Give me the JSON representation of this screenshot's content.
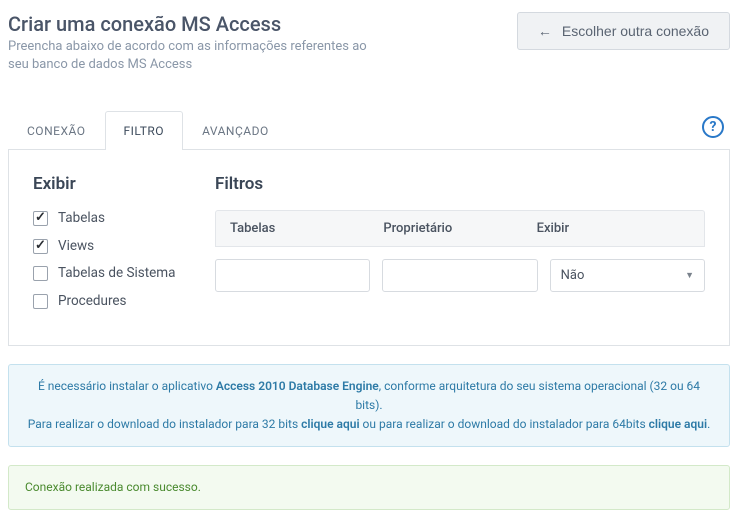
{
  "header": {
    "title": "Criar uma conexão MS Access",
    "subtitle": "Preencha abaixo de acordo com as informações referentes ao seu banco de dados MS Access",
    "choose_other": "Escolher outra conexão"
  },
  "tabs": {
    "items": [
      {
        "label": "CONEXÃO"
      },
      {
        "label": "FILTRO"
      },
      {
        "label": "AVANÇADO"
      }
    ]
  },
  "exibir_section": {
    "title": "Exibir",
    "options": [
      {
        "label": "Tabelas",
        "checked": true
      },
      {
        "label": "Views",
        "checked": true
      },
      {
        "label": "Tabelas de Sistema",
        "checked": false
      },
      {
        "label": "Procedures",
        "checked": false
      }
    ]
  },
  "filtros_section": {
    "title": "Filtros",
    "columns": {
      "tabelas": "Tabelas",
      "proprietario": "Proprietário",
      "exibir": "Exibir"
    },
    "row": {
      "tabelas_value": "",
      "proprietario_value": "",
      "exibir_value": "Não"
    }
  },
  "info_alert": {
    "pre": "É necessário instalar o aplicativo ",
    "bold": "Access 2010 Database Engine",
    "post": ", conforme arquitetura do seu sistema operacional (32 ou 64 bits).",
    "line2_pre": "Para realizar o download do instalador para 32 bits ",
    "link1": "clique aqui",
    "line2_mid": " ou para realizar o download do instalador para 64bits ",
    "link2": "clique aqui",
    "line2_end": "."
  },
  "success_alert": {
    "text": "Conexão realizada com sucesso."
  }
}
